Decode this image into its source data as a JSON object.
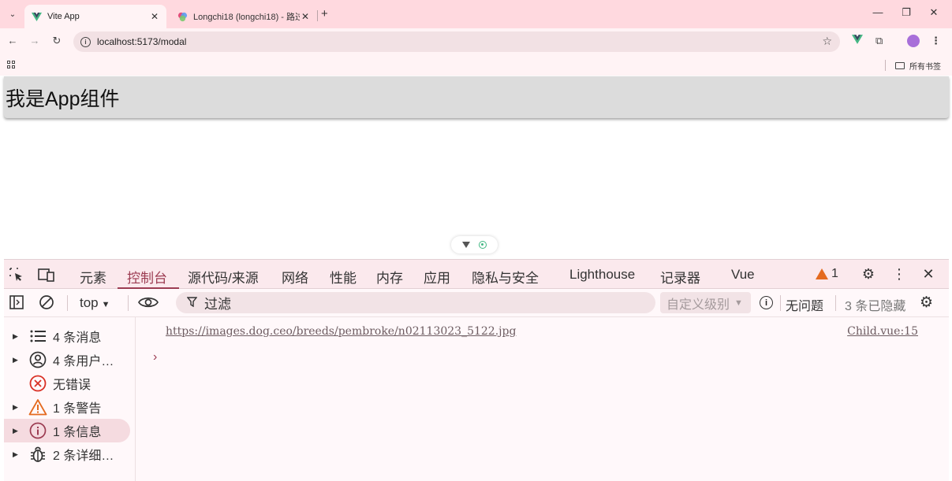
{
  "browser": {
    "tabs": [
      {
        "title": "Vite App",
        "active": true,
        "favicon": "vue-logo-icon"
      },
      {
        "title": "Longchi18 (longchi18) - 路过",
        "active": false,
        "favicon": "gitee-logo-icon"
      }
    ],
    "address": {
      "url": "localhost:5173/modal"
    },
    "bookmarks": {
      "all_bookmarks_label": "所有书签"
    }
  },
  "page": {
    "app_heading": "我是App组件"
  },
  "devtools": {
    "tabs": [
      "元素",
      "控制台",
      "源代码/来源",
      "网络",
      "性能",
      "内存",
      "应用",
      "隐私与安全",
      "Lighthouse",
      "记录器",
      "Vue"
    ],
    "active_tab": "控制台",
    "warning_count": "1",
    "filter": {
      "context": "top",
      "placeholder": "过滤",
      "levels": "自定义级别",
      "issues": "无问题",
      "hidden": "3 条已隐藏"
    },
    "sidebar": [
      {
        "label": "4 条消息",
        "icon": "list-icon",
        "expandable": true
      },
      {
        "label": "4 条用户…",
        "icon": "user-icon",
        "expandable": true
      },
      {
        "label": "无错误",
        "icon": "error-icon",
        "expandable": false
      },
      {
        "label": "1 条警告",
        "icon": "warning-icon",
        "expandable": true
      },
      {
        "label": "1 条信息",
        "icon": "info-icon",
        "expandable": true,
        "selected": true
      },
      {
        "label": "2 条详细…",
        "icon": "bug-icon",
        "expandable": true
      }
    ],
    "console": {
      "message": "https://images.dog.ceo/breeds/pembroke/n02113023_5122.jpg",
      "source": "Child.vue:15",
      "prompt": "›"
    }
  },
  "colors": {
    "tab_strip": "#ffd9df",
    "accent": "#9c3c52",
    "warning": "#e46a1f",
    "error": "#d93025",
    "vue_green": "#42b883"
  }
}
